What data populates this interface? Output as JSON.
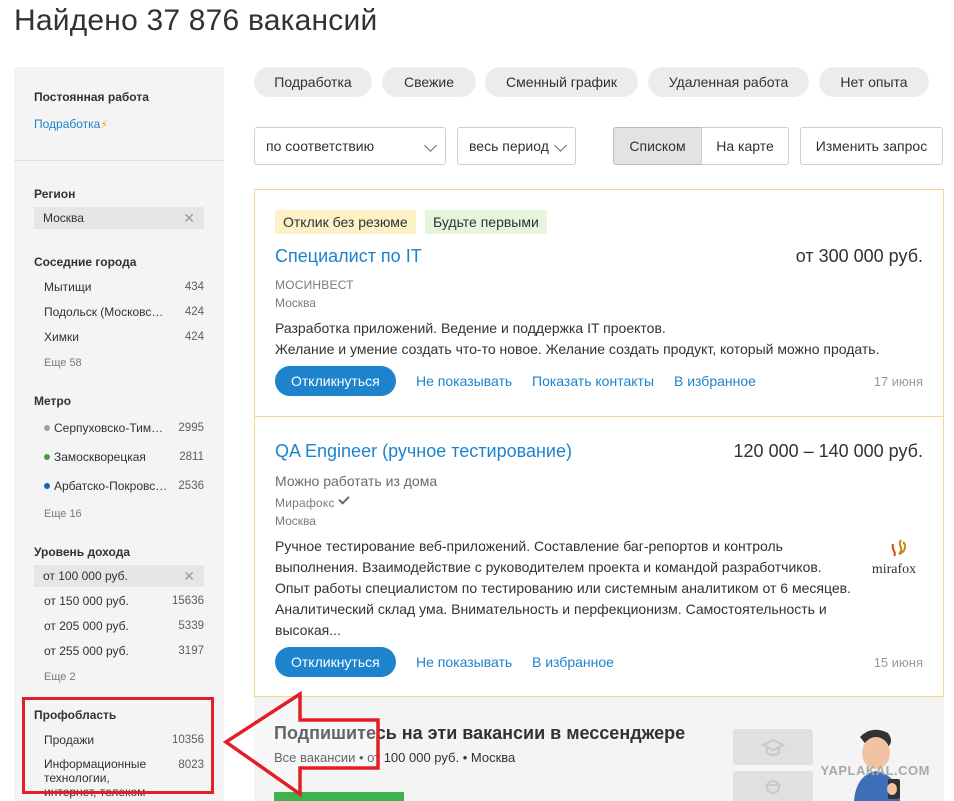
{
  "header": {
    "title": "Найдено 37 876 вакансий"
  },
  "sidebar": {
    "employment": {
      "title": "Постоянная работа",
      "link": "Подработка",
      "bolt": "⚡"
    },
    "region": {
      "title": "Регион",
      "selected": "Москва",
      "clear": "✕"
    },
    "nearby": {
      "title": "Соседние города",
      "items": [
        {
          "name": "Мытищи",
          "count": "434"
        },
        {
          "name": "Подольск (Московская область)",
          "count": "424"
        },
        {
          "name": "Химки",
          "count": "424"
        }
      ],
      "more": "Еще 58"
    },
    "metro": {
      "title": "Метро",
      "items": [
        {
          "name": "Серпуховско-Тимирязевская",
          "count": "2995",
          "color": "#9e9e9e"
        },
        {
          "name": "Замоскворецкая",
          "count": "2811",
          "color": "#43a047"
        },
        {
          "name": "Арбатско-Покровская",
          "count": "2536",
          "color": "#1565c0"
        }
      ],
      "more": "Еще 16"
    },
    "income": {
      "title": "Уровень дохода",
      "selected": "от 100 000 руб.",
      "clear": "✕",
      "items": [
        {
          "name": "от 150 000 руб.",
          "count": "15636"
        },
        {
          "name": "от 205 000 руб.",
          "count": "5339"
        },
        {
          "name": "от 255 000 руб.",
          "count": "3197"
        }
      ],
      "more": "Еще 2"
    },
    "profarea": {
      "title": "Профобласть",
      "items": [
        {
          "name": "Продажи",
          "count": "10356"
        },
        {
          "name": "Информационные технологии,",
          "name2": "интернет, телеком",
          "count": "8023"
        }
      ]
    }
  },
  "quick_filters": [
    "Подработка",
    "Свежие",
    "Сменный график",
    "Удаленная работа",
    "Нет опыта"
  ],
  "controls": {
    "sort": "по соответствию",
    "period": "весь период",
    "view_list": "Списком",
    "view_map": "На карте",
    "change_query": "Изменить запрос"
  },
  "vacancies": [
    {
      "tags": [
        "Отклик без резюме",
        "Будьте первыми"
      ],
      "title": "Специалист по IT",
      "salary": "от 300 000 руб.",
      "company": "МОСИНВЕСТ",
      "city": "Москва",
      "desc": [
        "Разработка приложений. Ведение и поддержка IT проектов.",
        "Желание и умение создать что-то новое. Желание создать продукт, который можно продать."
      ],
      "respond": "Откликнуться",
      "actions": [
        "Не показывать",
        "Показать контакты",
        "В избранное"
      ],
      "date": "17 июня"
    },
    {
      "title": "QA Engineer (ручное тестирование)",
      "salary": "120 000 – 140 000 руб.",
      "remote": "Можно работать из дома",
      "company": "Мирафокс",
      "city": "Москва",
      "logo": "mirafox",
      "desc": [
        "Ручное тестирование веб-приложений. Составление баг-репортов и контроль",
        "выполнения. Взаимодействие с руководителем проекта и командой разработчиков.",
        "Опыт работы специалистом по тестированию или системным аналитиком от 6 месяцев.",
        "Аналитический склад ума. Внимательность и перфекционизм. Самостоятельность и",
        "высокая..."
      ],
      "respond": "Откликнуться",
      "actions": [
        "Не показывать",
        "В избранное"
      ],
      "date": "15 июня"
    }
  ],
  "subscribe": {
    "title": "Подпишитесь на эти вакансии в мессенджере",
    "text": "Все вакансии • от 100 000 руб. • Москва"
  },
  "watermark": "YAPLAKAL.COM",
  "colors": {
    "link": "#1d83cc",
    "highlight_border": "#f1d98a",
    "annotation": "#e21f26"
  }
}
